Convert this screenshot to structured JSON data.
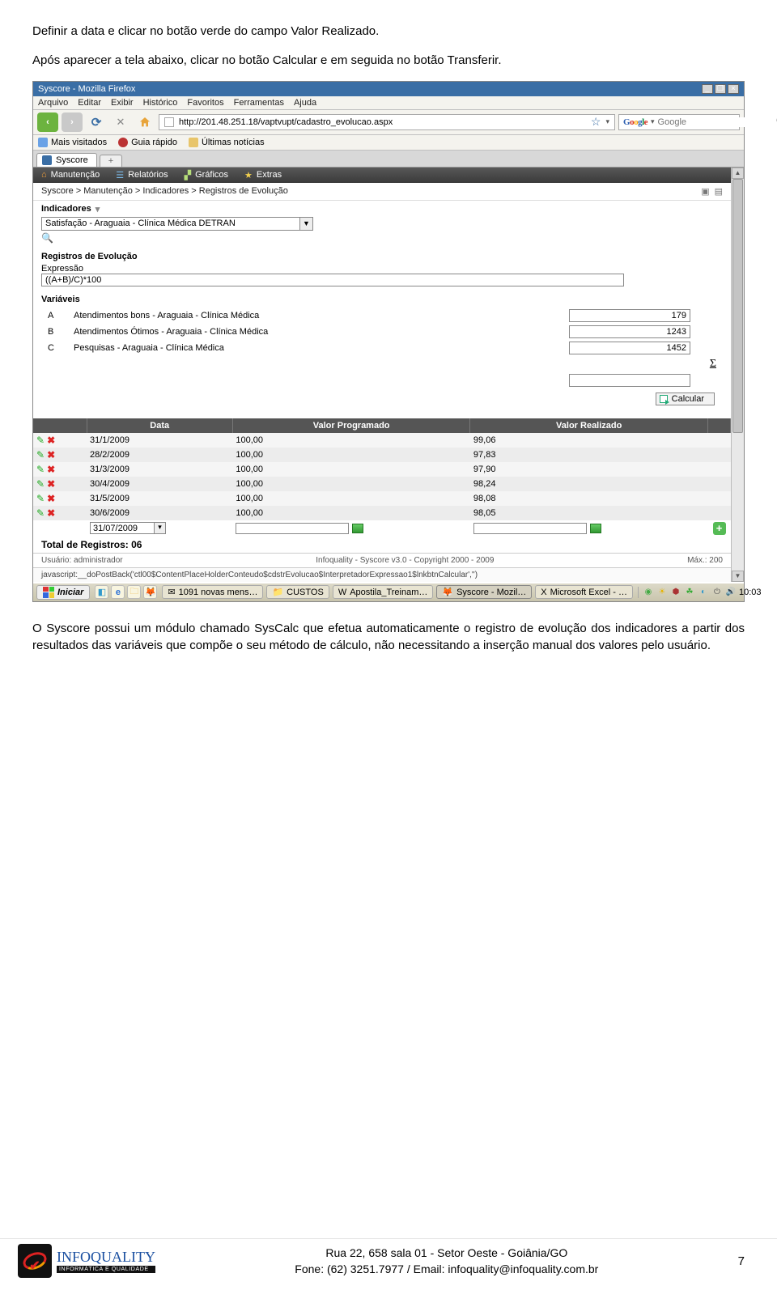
{
  "doc": {
    "para1": "Definir a data e clicar no botão verde do campo Valor Realizado.",
    "para2": "Após aparecer a tela abaixo, clicar no botão Calcular e em seguida no botão Transferir.",
    "para3": "O Syscore possui um módulo chamado SysCalc que efetua automaticamente o registro de evolução dos indicadores a partir dos resultados das variáveis que compõe o seu método de cálculo, não necessitando a inserção manual dos valores pelo usuário."
  },
  "titlebar": {
    "title": "Syscore - Mozilla Firefox"
  },
  "titlebar_btns": {
    "min": "_",
    "max": "❐",
    "close": "×"
  },
  "menubar": {
    "items": [
      "Arquivo",
      "Editar",
      "Exibir",
      "Histórico",
      "Favoritos",
      "Ferramentas",
      "Ajuda"
    ]
  },
  "navbar": {
    "url": "http://201.48.251.18/vaptvupt/cadastro_evolucao.aspx",
    "google_placeholder": "Google"
  },
  "bookmarks": {
    "items": [
      "Mais visitados",
      "Guia rápido",
      "Últimas notícias"
    ]
  },
  "tab": {
    "label": "Syscore",
    "plus": "+"
  },
  "appnav": {
    "items": [
      "Manutenção",
      "Relatórios",
      "Gráficos",
      "Extras"
    ]
  },
  "breadcrumb": {
    "path": "Syscore > Manutenção > Indicadores > Registros de Evolução"
  },
  "indicadores": {
    "label": "Indicadores",
    "value": "Satisfação - Araguaia - Clínica Médica DETRAN"
  },
  "registros_label": "Registros de Evolução",
  "expressao": {
    "label": "Expressão",
    "value": "((A+B)/C)*100"
  },
  "variaveis": {
    "label": "Variáveis",
    "rows": [
      {
        "sym": "A",
        "desc": "Atendimentos bons - Araguaia - Clínica Médica",
        "val": "179"
      },
      {
        "sym": "B",
        "desc": "Atendimentos Ótimos - Araguaia - Clínica Médica",
        "val": "1243"
      },
      {
        "sym": "C",
        "desc": "Pesquisas - Araguaia - Clínica Médica",
        "val": "1452"
      }
    ],
    "result": ""
  },
  "calcular_label": "Calcular",
  "grid": {
    "headers": [
      "",
      "Data",
      "Valor Programado",
      "Valor Realizado",
      ""
    ],
    "rows": [
      {
        "data": "31/1/2009",
        "prog": "100,00",
        "real": "99,06"
      },
      {
        "data": "28/2/2009",
        "prog": "100,00",
        "real": "97,83"
      },
      {
        "data": "31/3/2009",
        "prog": "100,00",
        "real": "97,90"
      },
      {
        "data": "30/4/2009",
        "prog": "100,00",
        "real": "98,24"
      },
      {
        "data": "31/5/2009",
        "prog": "100,00",
        "real": "98,08"
      },
      {
        "data": "30/6/2009",
        "prog": "100,00",
        "real": "98,05"
      }
    ],
    "new_date": "31/07/2009"
  },
  "total": "Total de Registros: 06",
  "status": {
    "left": "Usuário: administrador",
    "center": "Infoquality - Syscore v3.0 - Copyright 2000 - 2009",
    "right": "Máx.: 200"
  },
  "jsline": "javascript:__doPostBack('ctl00$ContentPlaceHolderConteudo$cdstrEvolucao$InterpretadorExpressao1$lnkbtnCalcular','')",
  "taskbar": {
    "start": "Iniciar",
    "tasks": [
      {
        "icon": "✉",
        "label": "1091 novas mens…"
      },
      {
        "icon": "📁",
        "label": "CUSTOS"
      },
      {
        "icon": "W",
        "label": "Apostila_Treinam…"
      },
      {
        "icon": "🦊",
        "label": "Syscore - Mozil…",
        "active": true
      },
      {
        "icon": "X",
        "label": "Microsoft Excel - …"
      }
    ],
    "clock": "10:03"
  },
  "footer": {
    "brand": "INFOQUALITY",
    "subbrand": "INFORMÁTICA E QUALIDADE",
    "line1": "Rua 22, 658 sala 01 - Setor Oeste - Goiânia/GO",
    "line2": "Fone: (62) 3251.7977 / Email: infoquality@infoquality.com.br",
    "pagenum": "7"
  }
}
